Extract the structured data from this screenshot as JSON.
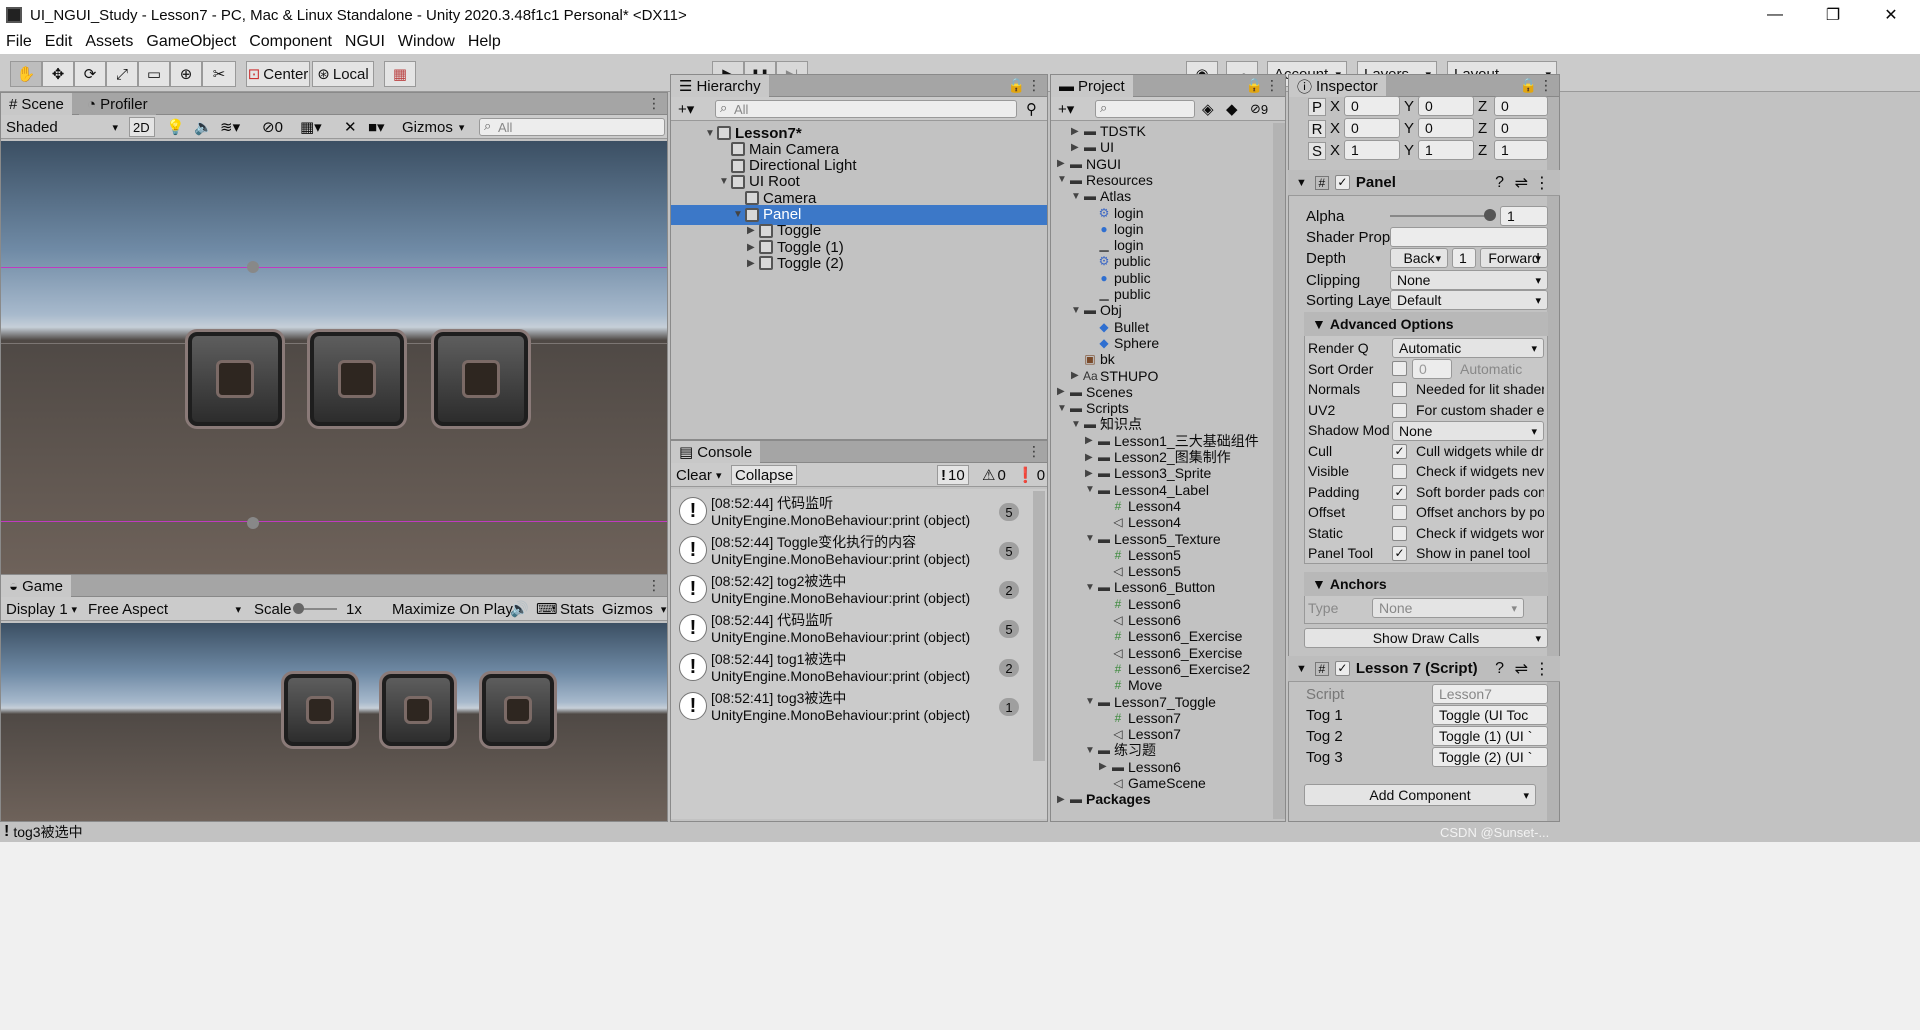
{
  "window": {
    "title": "UI_NGUI_Study - Lesson7 - PC, Mac & Linux Standalone - Unity 2020.3.48f1c1 Personal* <DX11>",
    "min": "—",
    "max": "❐",
    "close": "✕"
  },
  "menu": [
    "File",
    "Edit",
    "Assets",
    "GameObject",
    "Component",
    "NGUI",
    "Window",
    "Help"
  ],
  "toolbar": {
    "center": "Center",
    "local": "Local",
    "account": "Account",
    "layers": "Layers",
    "layout": "Layout",
    "play": "▶",
    "pause": "❚❚",
    "step": "▶|"
  },
  "scene": {
    "tab_scene": "Scene",
    "tab_profiler": "Profiler",
    "shading": "Shaded",
    "mode2d": "2D",
    "gizmos": "Gizmos",
    "search_placeholder": "All",
    "audio_count": "0"
  },
  "game": {
    "tab": "Game",
    "display": "Display 1",
    "aspect": "Free Aspect",
    "scale_label": "Scale",
    "scale_value": "1x",
    "maximize": "Maximize On Play",
    "stats": "Stats",
    "gizmos": "Gizmos"
  },
  "hierarchy": {
    "tab": "Hierarchy",
    "search_placeholder": "All",
    "items": [
      {
        "label": "Lesson7*",
        "depth": 0,
        "arrow": "▼",
        "bold": true
      },
      {
        "label": "Main Camera",
        "depth": 1,
        "arrow": ""
      },
      {
        "label": "Directional Light",
        "depth": 1,
        "arrow": ""
      },
      {
        "label": "UI Root",
        "depth": 1,
        "arrow": "▼"
      },
      {
        "label": "Camera",
        "depth": 2,
        "arrow": ""
      },
      {
        "label": "Panel",
        "depth": 2,
        "arrow": "▼",
        "selected": true
      },
      {
        "label": "Toggle",
        "depth": 3,
        "arrow": "▶"
      },
      {
        "label": "Toggle (1)",
        "depth": 3,
        "arrow": "▶"
      },
      {
        "label": "Toggle (2)",
        "depth": 3,
        "arrow": "▶"
      }
    ]
  },
  "console": {
    "tab": "Console",
    "clear": "Clear",
    "collapse": "Collapse",
    "count_info": "10",
    "count_warn": "0",
    "count_err": "0",
    "entries": [
      {
        "line1": "[08:52:44] 代码监听",
        "line2": "UnityEngine.MonoBehaviour:print (object)",
        "count": "5"
      },
      {
        "line1": "[08:52:44] Toggle变化执行的内容",
        "line2": "UnityEngine.MonoBehaviour:print (object)",
        "count": "5"
      },
      {
        "line1": "[08:52:42] tog2被选中",
        "line2": "UnityEngine.MonoBehaviour:print (object)",
        "count": "2"
      },
      {
        "line1": "[08:52:44] 代码监听",
        "line2": "UnityEngine.MonoBehaviour:print (object)",
        "count": "5"
      },
      {
        "line1": "[08:52:44] tog1被选中",
        "line2": "UnityEngine.MonoBehaviour:print (object)",
        "count": "2"
      },
      {
        "line1": "[08:52:41] tog3被选中",
        "line2": "UnityEngine.MonoBehaviour:print (object)",
        "count": "1"
      }
    ]
  },
  "project": {
    "tab": "Project",
    "count": "9",
    "items": [
      {
        "label": "TDSTK",
        "depth": 1,
        "arrow": "▶",
        "icon": "folder"
      },
      {
        "label": "UI",
        "depth": 1,
        "arrow": "▶",
        "icon": "folder"
      },
      {
        "label": "NGUI",
        "depth": 0,
        "arrow": "▶",
        "icon": "folder"
      },
      {
        "label": "Resources",
        "depth": 0,
        "arrow": "▼",
        "icon": "folder"
      },
      {
        "label": "Atlas",
        "depth": 1,
        "arrow": "▼",
        "icon": "folder"
      },
      {
        "label": "login",
        "depth": 2,
        "arrow": "",
        "icon": "asset"
      },
      {
        "label": "login",
        "depth": 2,
        "arrow": "",
        "icon": "material"
      },
      {
        "label": "login",
        "depth": 2,
        "arrow": "",
        "icon": "texture"
      },
      {
        "label": "public",
        "depth": 2,
        "arrow": "",
        "icon": "asset"
      },
      {
        "label": "public",
        "depth": 2,
        "arrow": "",
        "icon": "material"
      },
      {
        "label": "public",
        "depth": 2,
        "arrow": "",
        "icon": "texture"
      },
      {
        "label": "Obj",
        "depth": 1,
        "arrow": "▼",
        "icon": "folder"
      },
      {
        "label": "Bullet",
        "depth": 2,
        "arrow": "",
        "icon": "prefab"
      },
      {
        "label": "Sphere",
        "depth": 2,
        "arrow": "",
        "icon": "prefab"
      },
      {
        "label": "bk",
        "depth": 1,
        "arrow": "",
        "icon": "image"
      },
      {
        "label": "STHUPO",
        "depth": 1,
        "arrow": "▶",
        "icon": "font"
      },
      {
        "label": "Scenes",
        "depth": 0,
        "arrow": "▶",
        "icon": "folder"
      },
      {
        "label": "Scripts",
        "depth": 0,
        "arrow": "▼",
        "icon": "folder"
      },
      {
        "label": "知识点",
        "depth": 1,
        "arrow": "▼",
        "icon": "folder"
      },
      {
        "label": "Lesson1_三大基础组件",
        "depth": 2,
        "arrow": "▶",
        "icon": "folder"
      },
      {
        "label": "Lesson2_图集制作",
        "depth": 2,
        "arrow": "▶",
        "icon": "folder"
      },
      {
        "label": "Lesson3_Sprite",
        "depth": 2,
        "arrow": "▶",
        "icon": "folder"
      },
      {
        "label": "Lesson4_Label",
        "depth": 2,
        "arrow": "▼",
        "icon": "folder"
      },
      {
        "label": "Lesson4",
        "depth": 3,
        "arrow": "",
        "icon": "script"
      },
      {
        "label": "Lesson4",
        "depth": 3,
        "arrow": "",
        "icon": "scene"
      },
      {
        "label": "Lesson5_Texture",
        "depth": 2,
        "arrow": "▼",
        "icon": "folder"
      },
      {
        "label": "Lesson5",
        "depth": 3,
        "arrow": "",
        "icon": "script"
      },
      {
        "label": "Lesson5",
        "depth": 3,
        "arrow": "",
        "icon": "scene"
      },
      {
        "label": "Lesson6_Button",
        "depth": 2,
        "arrow": "▼",
        "icon": "folder"
      },
      {
        "label": "Lesson6",
        "depth": 3,
        "arrow": "",
        "icon": "script"
      },
      {
        "label": "Lesson6",
        "depth": 3,
        "arrow": "",
        "icon": "scene"
      },
      {
        "label": "Lesson6_Exercise",
        "depth": 3,
        "arrow": "",
        "icon": "script"
      },
      {
        "label": "Lesson6_Exercise",
        "depth": 3,
        "arrow": "",
        "icon": "scene"
      },
      {
        "label": "Lesson6_Exercise2",
        "depth": 3,
        "arrow": "",
        "icon": "script"
      },
      {
        "label": "Move",
        "depth": 3,
        "arrow": "",
        "icon": "script"
      },
      {
        "label": "Lesson7_Toggle",
        "depth": 2,
        "arrow": "▼",
        "icon": "folder"
      },
      {
        "label": "Lesson7",
        "depth": 3,
        "arrow": "",
        "icon": "script"
      },
      {
        "label": "Lesson7",
        "depth": 3,
        "arrow": "",
        "icon": "scene"
      },
      {
        "label": "练习题",
        "depth": 2,
        "arrow": "▼",
        "icon": "folder"
      },
      {
        "label": "Lesson6",
        "depth": 3,
        "arrow": "▶",
        "icon": "folder"
      },
      {
        "label": "GameScene",
        "depth": 3,
        "arrow": "",
        "icon": "scene"
      },
      {
        "label": "Packages",
        "depth": 0,
        "arrow": "▶",
        "icon": "folder",
        "bold": true
      }
    ]
  },
  "inspector": {
    "tab": "Inspector",
    "transform": {
      "P": [
        "0",
        "0",
        "0"
      ],
      "R": [
        "0",
        "0",
        "0"
      ],
      "S": [
        "1",
        "1",
        "1"
      ],
      "x": "X",
      "y": "Y",
      "z": "Z"
    },
    "panel_title": "Panel",
    "alpha_label": "Alpha",
    "alpha_value": "1",
    "alpha_level": 1,
    "shader_label": "Shader Prop.",
    "depth_label": "Depth",
    "back": "Back",
    "depth_value": "1",
    "forward": "Forward",
    "clipping_label": "Clipping",
    "clipping_value": "None",
    "sorting_label": "Sorting Layer",
    "sorting_value": "Default",
    "advanced": "Advanced Options",
    "renderq_label": "Render Q",
    "renderq_value": "Automatic",
    "sortorder_label": "Sort Order",
    "sortorder_value": "0",
    "sortorder_auto": "Automatic",
    "options": [
      {
        "label": "Normals",
        "checked": false,
        "text": "Needed for lit shaders"
      },
      {
        "label": "UV2",
        "checked": false,
        "text": "For custom shader ef"
      },
      {
        "label": "Shadow Mode",
        "dropdown": "None"
      },
      {
        "label": "Cull",
        "checked": true,
        "text": "Cull widgets while dr"
      },
      {
        "label": "Visible",
        "checked": false,
        "text": "Check if widgets nev"
      },
      {
        "label": "Padding",
        "checked": true,
        "text": "Soft border pads cont"
      },
      {
        "label": "Offset",
        "checked": false,
        "text": "Offset anchors by pos"
      },
      {
        "label": "Static",
        "checked": false,
        "text": "Check if widgets wor"
      },
      {
        "label": "Panel Tool",
        "checked": true,
        "text": "Show in panel tool"
      }
    ],
    "anchors": "Anchors",
    "type_label": "Type",
    "type_value": "None",
    "draw_calls": "Show Draw Calls",
    "script_title": "Lesson 7 (Script)",
    "script_label": "Script",
    "script_value": "Lesson7",
    "tog1_label": "Tog 1",
    "tog1_value": "Toggle (UI Toc",
    "tog2_label": "Tog 2",
    "tog2_value": "Toggle (1) (UI `",
    "tog3_label": "Tog 3",
    "tog3_value": "Toggle (2) (UI `",
    "add_component": "Add Component"
  },
  "statusbar": {
    "message": "tog3被选中",
    "watermark": "CSDN @Sunset-..."
  }
}
